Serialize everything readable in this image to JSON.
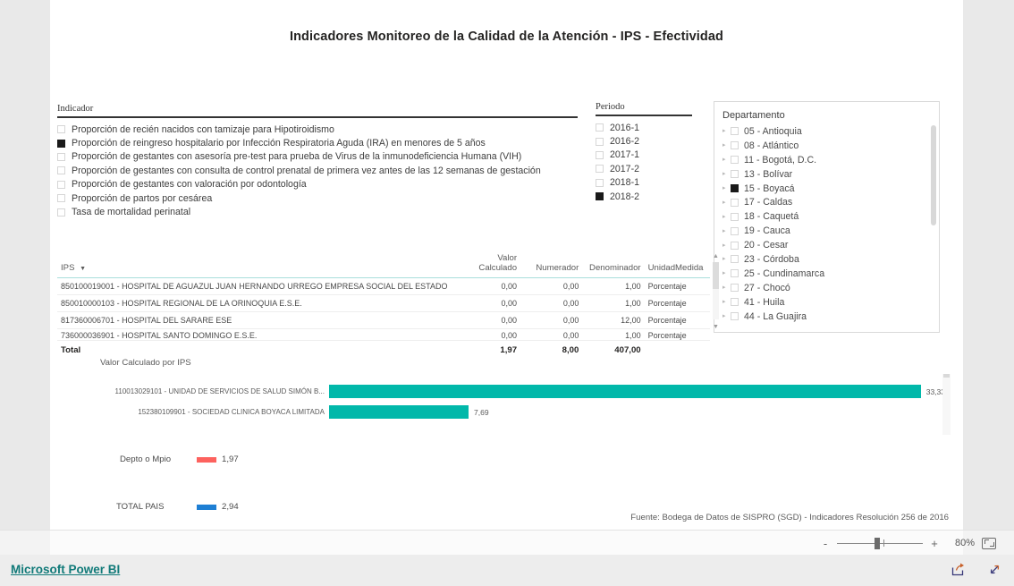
{
  "report": {
    "title": "Indicadores Monitoreo de la Calidad de la Atención - IPS - Efectividad",
    "source_note": "Fuente: Bodega de Datos de SISPRO (SGD) - Indicadores Resolución 256 de 2016",
    "accent_teal": "#01B8AA",
    "accent_orange": "#FD625E",
    "accent_blue": "#1E7FD4"
  },
  "slicers": {
    "indicador": {
      "header": "Indicador",
      "options": [
        {
          "label": "Proporción de recién nacidos con tamizaje para Hipotiroidismo",
          "checked": false
        },
        {
          "label": "Proporción de reingreso hospitalario por Infección Respiratoria Aguda (IRA) en menores de 5 años",
          "checked": true
        },
        {
          "label": "Proporción de gestantes con asesoría pre-test para prueba de Virus de la inmunodeficiencia Humana (VIH)",
          "checked": false
        },
        {
          "label": "Proporción de gestantes con consulta de control prenatal de primera vez antes de las 12 semanas de gestación",
          "checked": false
        },
        {
          "label": "Proporción de gestantes con valoración por odontología",
          "checked": false
        },
        {
          "label": "Proporción de partos por cesárea",
          "checked": false
        },
        {
          "label": "Tasa de mortalidad perinatal",
          "checked": false
        }
      ]
    },
    "periodo": {
      "header": "Periodo",
      "options": [
        {
          "label": "2016-1",
          "checked": false
        },
        {
          "label": "2016-2",
          "checked": false
        },
        {
          "label": "2017-1",
          "checked": false
        },
        {
          "label": "2017-2",
          "checked": false
        },
        {
          "label": "2018-1",
          "checked": false
        },
        {
          "label": "2018-2",
          "checked": true
        }
      ]
    },
    "departamento": {
      "header": "Departamento",
      "options": [
        {
          "label": "05 - Antioquia",
          "checked": false
        },
        {
          "label": "08 - Atlántico",
          "checked": false
        },
        {
          "label": "11 - Bogotá, D.C.",
          "checked": false
        },
        {
          "label": "13 - Bolívar",
          "checked": false
        },
        {
          "label": "15 - Boyacá",
          "checked": true
        },
        {
          "label": "17 - Caldas",
          "checked": false
        },
        {
          "label": "18 - Caquetá",
          "checked": false
        },
        {
          "label": "19 - Cauca",
          "checked": false
        },
        {
          "label": "20 - Cesar",
          "checked": false
        },
        {
          "label": "23 - Córdoba",
          "checked": false
        },
        {
          "label": "25 - Cundinamarca",
          "checked": false
        },
        {
          "label": "27 - Chocó",
          "checked": false
        },
        {
          "label": "41 - Huila",
          "checked": false
        },
        {
          "label": "44 - La Guajira",
          "checked": false
        }
      ]
    }
  },
  "table": {
    "columns": [
      "IPS",
      "Valor Calculado",
      "Numerador",
      "Denominador",
      "UnidadMedida"
    ],
    "sorted_column": "IPS",
    "rows": [
      {
        "ips": "850100019001 - HOSPITAL DE AGUAZUL JUAN HERNANDO URREGO EMPRESA SOCIAL DEL ESTADO",
        "valor": "0,00",
        "numerador": "0,00",
        "denominador": "1,00",
        "unidad": "Porcentaje"
      },
      {
        "ips": "850010000103 - HOSPITAL REGIONAL DE LA ORINOQUIA E.S.E.",
        "valor": "0,00",
        "numerador": "0,00",
        "denominador": "1,00",
        "unidad": "Porcentaje"
      },
      {
        "ips": "817360006701 - HOSPITAL DEL SARARE ESE",
        "valor": "0,00",
        "numerador": "0,00",
        "denominador": "12,00",
        "unidad": "Porcentaje"
      },
      {
        "ips": "736000036901 - HOSPITAL SANTO DOMINGO E.S.E.",
        "valor": "0,00",
        "numerador": "0,00",
        "denominador": "1,00",
        "unidad": "Porcentaje"
      }
    ],
    "total": {
      "label": "Total",
      "valor": "1,97",
      "numerador": "8,00",
      "denominador": "407,00",
      "unidad": ""
    }
  },
  "chart_data": {
    "type": "bar",
    "title": "Valor Calculado por IPS",
    "orientation": "horizontal",
    "categories": [
      "110013029101 - UNIDAD DE SERVICIOS DE SALUD SIMÓN B...",
      "152380109901 - SOCIEDAD CLINICA BOYACA LIMITADA"
    ],
    "values": [
      33.33,
      7.69
    ],
    "value_labels": [
      "33,33",
      "7,69"
    ],
    "xlabel": "",
    "ylabel": "",
    "xlim": [
      0,
      34.5
    ],
    "grid": false,
    "legend": "none",
    "series_color": "#01B8AA"
  },
  "kpis": [
    {
      "label": "Depto o Mpio",
      "value": "1,97",
      "color": "#FD625E"
    },
    {
      "label": "TOTAL PAIS",
      "value": "2,94",
      "color": "#1E7FD4"
    }
  ],
  "toolbar": {
    "zoom_minus": "-",
    "zoom_plus": "+",
    "zoom_percent": "80%"
  },
  "bottom": {
    "brand": "Microsoft Power BI"
  }
}
